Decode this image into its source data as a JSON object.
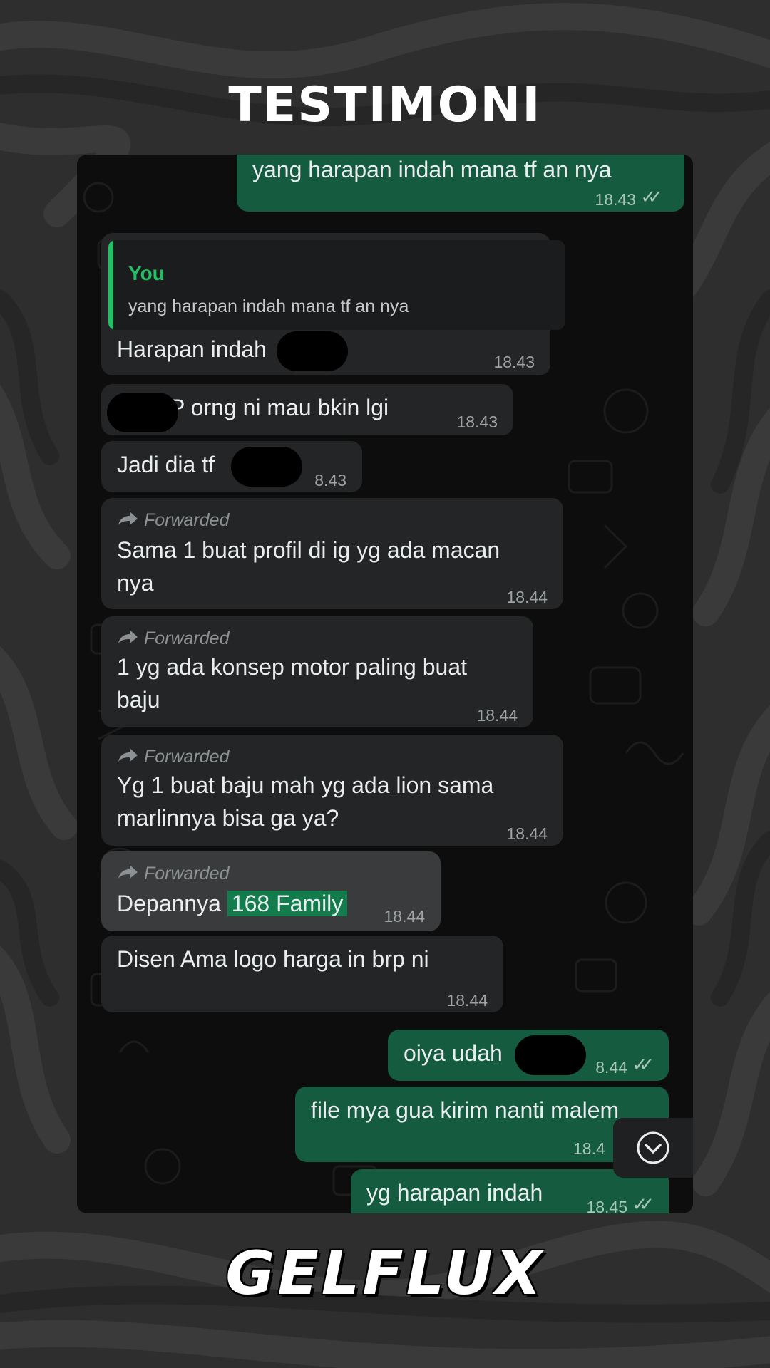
{
  "colors": {
    "background": "#2e2e2e",
    "chat_background": "#0d0d0d",
    "incoming_bubble": "#232526",
    "outgoing_bubble": "#145b3f",
    "accent_green": "#21c063"
  },
  "header": {
    "title": "TESTIMONI"
  },
  "watermark": "GELFLUX",
  "footer": {
    "brand": "GELFLUX"
  },
  "messages": [
    {
      "direction": "out",
      "text": "yang harapan indah mana tf an nya",
      "time": "18.43",
      "status": "read"
    },
    {
      "direction": "in",
      "quote": {
        "author": "You",
        "text": "yang harapan indah mana tf an nya"
      },
      "text": "Harapan indah",
      "time": "18.43",
      "redacted": true
    },
    {
      "direction": "in",
      "text": "P orng ni mau bkin lgi",
      "time": "18.43",
      "redacted": true
    },
    {
      "direction": "in",
      "text": "Jadi dia tf",
      "time": "8.43",
      "redacted": true
    },
    {
      "direction": "in",
      "forwarded_label": "Forwarded",
      "lines": [
        "Sama 1 buat profil di ig yg ada macan",
        "nya"
      ],
      "time": "18.44"
    },
    {
      "direction": "in",
      "forwarded_label": "Forwarded",
      "lines": [
        "1 yg ada konsep motor paling buat",
        "baju"
      ],
      "time": "18.44"
    },
    {
      "direction": "in",
      "forwarded_label": "Forwarded",
      "lines": [
        "Yg 1 buat baju mah yg ada lion sama",
        "marlinnya bisa ga ya?"
      ],
      "time": "18.44"
    },
    {
      "direction": "in",
      "forwarded_label": "Forwarded",
      "text": "Depannya",
      "highlight": "168 Family",
      "time": "18.44",
      "selected": true
    },
    {
      "direction": "in",
      "text": "Disen Ama logo harga in brp ni",
      "time": "18.44"
    },
    {
      "direction": "out",
      "text": "oiya udah",
      "time": "8.44",
      "status": "read",
      "redacted": true
    },
    {
      "direction": "out",
      "text": "file mya gua kirim nanti malem",
      "time": "18.4"
    },
    {
      "direction": "out",
      "text": "yg harapan indah",
      "time": "18.45",
      "status": "read"
    }
  ],
  "icons": {
    "forward": "forward-arrow-icon",
    "read": "double-check-icon",
    "scroll": "chevron-down-circle-icon"
  }
}
